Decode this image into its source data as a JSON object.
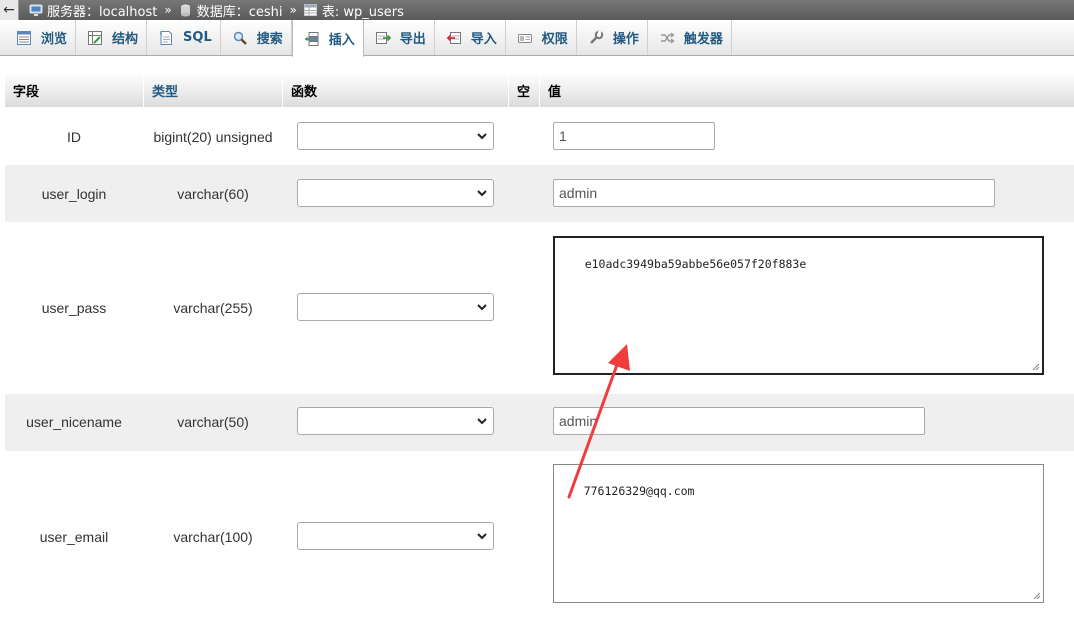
{
  "breadcrumb": {
    "server_label": "服务器：localhost",
    "db_label": "数据库：ceshi",
    "table_label": "表: wp_users",
    "separator": "»",
    "back_glyph": "←"
  },
  "tabs": [
    {
      "label": "浏览",
      "icon": "browse-icon"
    },
    {
      "label": "结构",
      "icon": "structure-icon"
    },
    {
      "label": "SQL",
      "icon": "sql-icon"
    },
    {
      "label": "搜索",
      "icon": "search-icon"
    },
    {
      "label": "插入",
      "icon": "insert-icon",
      "active": true
    },
    {
      "label": "导出",
      "icon": "export-icon"
    },
    {
      "label": "导入",
      "icon": "import-icon"
    },
    {
      "label": "权限",
      "icon": "privileges-icon"
    },
    {
      "label": "操作",
      "icon": "operations-icon"
    },
    {
      "label": "触发器",
      "icon": "triggers-icon"
    }
  ],
  "table_header": {
    "field": "字段",
    "type": "类型",
    "function": "函数",
    "null": "空",
    "value": "值"
  },
  "rows": [
    {
      "field": "ID",
      "type": "bigint(20) unsigned",
      "value": "1"
    },
    {
      "field": "user_login",
      "type": "varchar(60)",
      "value": "admin"
    },
    {
      "field": "user_pass",
      "type": "varchar(255)",
      "value": "e10adc3949ba59abbe56e057f20f883e"
    },
    {
      "field": "user_nicename",
      "type": "varchar(50)",
      "value": "admin"
    },
    {
      "field": "user_email",
      "type": "varchar(100)",
      "value": "776126329@qq.com"
    }
  ],
  "colors": {
    "tab_text": "#235a81",
    "annotation_arrow": "#f03c3c"
  }
}
